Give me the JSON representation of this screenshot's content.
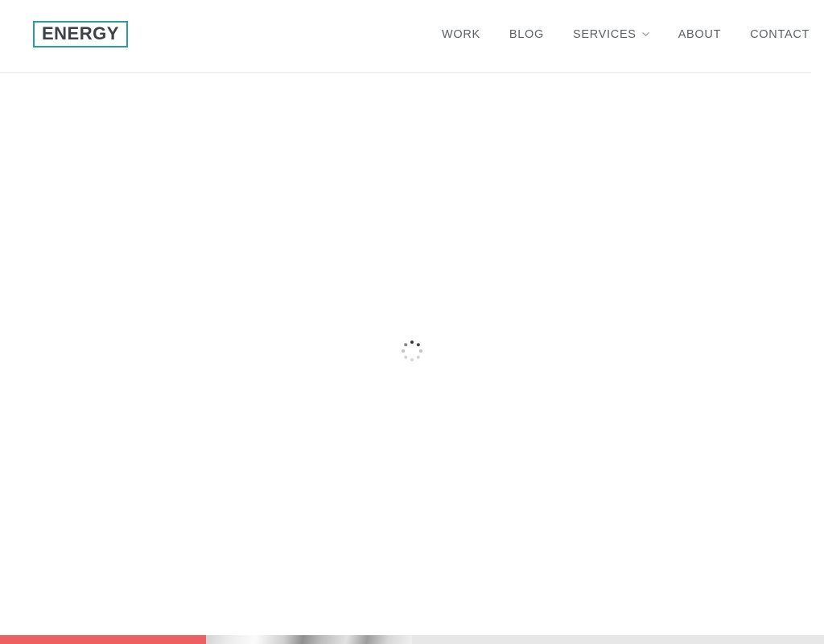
{
  "header": {
    "logo": {
      "text": "ENERGY",
      "border_color": "#2a9d9d",
      "text_color": "#3c4247"
    },
    "nav": [
      {
        "label": "WORK",
        "has_dropdown": false
      },
      {
        "label": "BLOG",
        "has_dropdown": false
      },
      {
        "label": "SERVICES",
        "has_dropdown": true,
        "dropdown_icon": "chevron-down-icon"
      },
      {
        "label": "ABOUT",
        "has_dropdown": false
      },
      {
        "label": "CONTACT",
        "has_dropdown": false
      }
    ]
  },
  "main": {
    "state": "loading",
    "loader": {
      "icon": "spinner-icon",
      "dot_count": 8,
      "color": "#3a3a3a"
    },
    "background_color": "#ffffff"
  },
  "below_fold": {
    "tiles": [
      {
        "name": "red-panel",
        "color": "#ee5f62"
      },
      {
        "name": "photo-thumbnail",
        "color": "#c8c8c8"
      },
      {
        "name": "grey-panel",
        "color": "#e7e7e7"
      }
    ]
  }
}
